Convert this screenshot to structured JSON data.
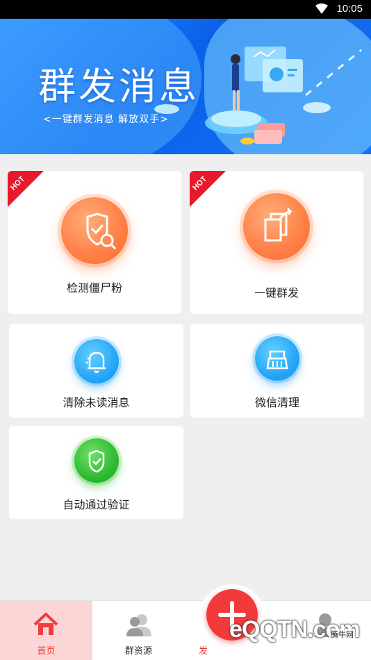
{
  "status_bar": {
    "time": "10:05"
  },
  "banner": {
    "title": "群发消息",
    "subtitle": "<一键群发消息   解放双手>"
  },
  "cards": [
    {
      "label": "检测僵尸粉",
      "badge": "HOT",
      "icon": "shield-search-icon"
    },
    {
      "label": "一键群发",
      "badge": "HOT",
      "icon": "send-share-icon"
    },
    {
      "label": "清除未读消息",
      "icon": "bell-clean-icon"
    },
    {
      "label": "微信清理",
      "icon": "broom-icon"
    },
    {
      "label": "自动通过验证",
      "icon": "shield-check-icon"
    }
  ],
  "bottom_nav": {
    "items": [
      {
        "label": "首页",
        "icon": "home-icon",
        "active": true
      },
      {
        "label": "群资源",
        "icon": "group-users-icon"
      },
      {
        "label": "发",
        "icon": "plus-icon"
      },
      {
        "label": "",
        "icon": "user-icon"
      }
    ]
  },
  "watermark": {
    "text": "eQQTN.com",
    "brand": "腾牛网"
  },
  "colors": {
    "accent_red": "#f23a3a",
    "hot_red": "#e8192c",
    "banner_blue": "#0a61e8",
    "active_tab_bg": "#fcd6d6"
  }
}
